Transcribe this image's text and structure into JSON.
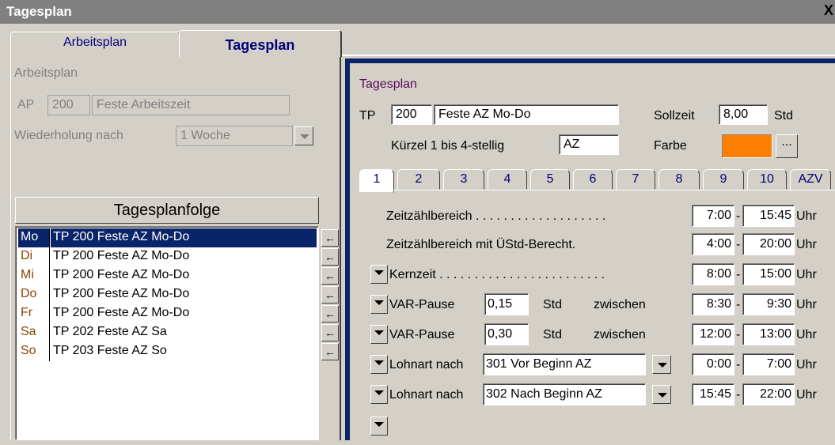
{
  "window": {
    "title": "Tagesplan",
    "close_label": "X"
  },
  "tabs": {
    "arbeitsplan": "Arbeitsplan",
    "tagesplan": "Tagesplan"
  },
  "left": {
    "section_label": "Arbeitsplan",
    "ap_label": "AP",
    "ap_number": "200",
    "ap_name": "Feste Arbeitszeit",
    "repeat_label": "Wiederholung nach",
    "repeat_value": "1 Woche",
    "sequence_header": "Tagesplanfolge",
    "rows": [
      {
        "day": "Mo",
        "plan": "TP 200  Feste AZ  Mo-Do"
      },
      {
        "day": "Di",
        "plan": "TP 200  Feste AZ  Mo-Do"
      },
      {
        "day": "Mi",
        "plan": "TP 200  Feste AZ  Mo-Do"
      },
      {
        "day": "Do",
        "plan": "TP 200  Feste AZ  Mo-Do"
      },
      {
        "day": "Fr",
        "plan": "TP 200  Feste AZ  Mo-Do"
      },
      {
        "day": "Sa",
        "plan": "TP 202  Feste AZ  Sa"
      },
      {
        "day": "So",
        "plan": "TP 203  Feste AZ  So"
      }
    ],
    "arrow_glyph": "←"
  },
  "right": {
    "section_label": "Tagesplan",
    "tp_label": "TP",
    "tp_number": "200",
    "tp_name": "Feste AZ  Mo-Do",
    "sollzeit_label": "Sollzeit",
    "sollzeit_value": "8,00",
    "std_label": "Std",
    "kuerzel_label": "Kürzel 1 bis 4-stellig",
    "kuerzel_value": "AZ",
    "farbe_label": "Farbe",
    "farbe_color": "#ff7f00",
    "farbe_button": "...",
    "day_tabs": [
      "1",
      "2",
      "3",
      "4",
      "5",
      "6",
      "7",
      "8",
      "9",
      "10",
      "AZV"
    ],
    "rows": {
      "zeitzaehl": {
        "label": "Zeitzählbereich . . . . . . . . . . . . . . . . . . .",
        "from": "7:00",
        "to": "15:45",
        "unit": "Uhr"
      },
      "zeitzaehl_ue": {
        "label": "Zeitzählbereich mit ÜStd-Berecht.",
        "from": "4:00",
        "to": "20:00",
        "unit": "Uhr"
      },
      "kernzeit": {
        "label": "Kernzeit . . . . . . . . . . . . . . . . . . . . . . . .",
        "from": "8:00",
        "to": "15:00",
        "unit": "Uhr"
      },
      "var1": {
        "label": "VAR-Pause",
        "hours": "0,15",
        "std": "Std",
        "between": "zwischen",
        "from": "8:30",
        "to": "9:30",
        "unit": "Uhr"
      },
      "var2": {
        "label": "VAR-Pause",
        "hours": "0,30",
        "std": "Std",
        "between": "zwischen",
        "from": "12:00",
        "to": "13:00",
        "unit": "Uhr"
      },
      "lohn1": {
        "label": "Lohnart  nach",
        "value": "301  Vor Beginn AZ",
        "from": "0:00",
        "to": "7:00",
        "unit": "Uhr"
      },
      "lohn2": {
        "label": "Lohnart  nach",
        "value": "302  Nach Beginn AZ",
        "from": "15:45",
        "to": "22:00",
        "unit": "Uhr"
      }
    },
    "dash": "-"
  }
}
